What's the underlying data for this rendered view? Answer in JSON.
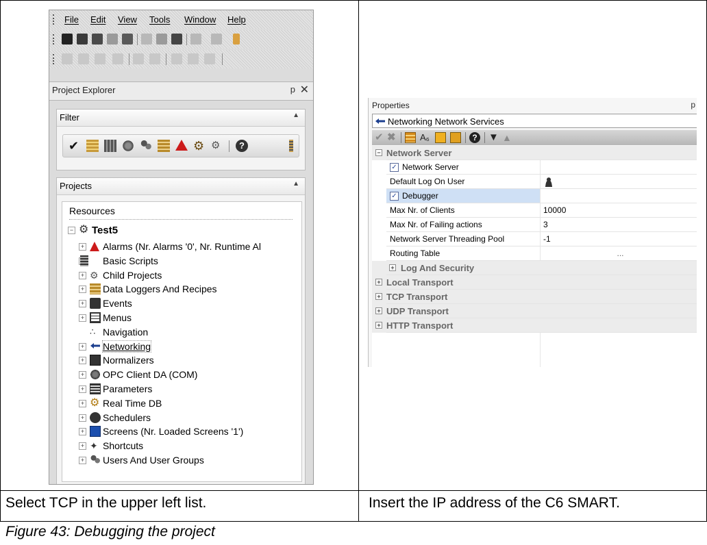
{
  "menu": {
    "items": [
      "File",
      "Edit",
      "View",
      "Tools",
      "Window",
      "Help"
    ]
  },
  "project_explorer": {
    "title": "Project Explorer",
    "pin_glyph": "p",
    "close_glyph": "✕",
    "filter": {
      "title": "Filter",
      "icons": [
        "check-icon",
        "alarm-list-icon",
        "network-icon",
        "opc-icon",
        "users-icon",
        "datalogger-icon",
        "alarm-bell-icon",
        "gear-icon",
        "child-gear-icon",
        "help-icon"
      ]
    },
    "projects": {
      "title": "Projects",
      "resources_label": "Resources",
      "root": {
        "label": "Test5",
        "icon": "project-gear-icon"
      },
      "items": [
        {
          "label": "Alarms (Nr. Alarms '0', Nr. Runtime Al",
          "icon": "alarm-bell-icon",
          "expandable": true
        },
        {
          "label": "Basic Scripts",
          "icon": "script-icon",
          "expandable": true
        },
        {
          "label": "Child Projects",
          "icon": "child-gear-icon",
          "expandable": true
        },
        {
          "label": "Data Loggers And Recipes",
          "icon": "datalogger-icon",
          "expandable": true
        },
        {
          "label": "Events",
          "icon": "events-icon",
          "expandable": true
        },
        {
          "label": "Menus",
          "icon": "menus-icon",
          "expandable": true
        },
        {
          "label": "Navigation",
          "icon": "navigation-icon",
          "expandable": false
        },
        {
          "label": "Networking",
          "icon": "networking-icon",
          "expandable": true,
          "selected": true
        },
        {
          "label": "Normalizers",
          "icon": "normalizers-icon",
          "expandable": true
        },
        {
          "label": "OPC Client DA (COM)",
          "icon": "opc-icon",
          "expandable": true
        },
        {
          "label": "Parameters",
          "icon": "parameters-icon",
          "expandable": true
        },
        {
          "label": "Real Time DB",
          "icon": "realtime-db-icon",
          "expandable": true
        },
        {
          "label": "Schedulers",
          "icon": "scheduler-icon",
          "expandable": true
        },
        {
          "label": "Screens (Nr. Loaded Screens '1')",
          "icon": "screen-icon",
          "expandable": true
        },
        {
          "label": "Shortcuts",
          "icon": "shortcut-icon",
          "expandable": true
        },
        {
          "label": "Users And User Groups",
          "icon": "users-icon",
          "expandable": true
        }
      ]
    }
  },
  "properties": {
    "title": "Properties",
    "pin_glyph": "p",
    "object_label": "Networking Network Services",
    "rows": [
      {
        "kind": "category",
        "label": "Network Server",
        "expander": "⊟"
      },
      {
        "kind": "checkbox",
        "label": "Network Server",
        "checked": true,
        "value": ""
      },
      {
        "kind": "prop",
        "label": "Default Log On User",
        "value": "",
        "value_icon": "user-icon"
      },
      {
        "kind": "checkbox",
        "label": "Debugger",
        "checked": true,
        "value": "",
        "selected": true
      },
      {
        "kind": "prop",
        "label": "Max Nr. of Clients",
        "value": "10000"
      },
      {
        "kind": "prop",
        "label": "Max Nr. of Failing actions",
        "value": "3"
      },
      {
        "kind": "prop",
        "label": "Network Server Threading Pool",
        "value": "-1"
      },
      {
        "kind": "prop",
        "label": "Routing Table",
        "value": "..."
      },
      {
        "kind": "subcategory",
        "label": "Log And Security",
        "expander": "⊞"
      },
      {
        "kind": "category",
        "label": "Local Transport",
        "expander": "⊞"
      },
      {
        "kind": "category",
        "label": "TCP Transport",
        "expander": "⊞"
      },
      {
        "kind": "category",
        "label": "UDP Transport",
        "expander": "⊞"
      },
      {
        "kind": "category",
        "label": "HTTP Transport",
        "expander": "⊞"
      }
    ]
  },
  "table": {
    "left_caption": "Select TCP in the upper left list.",
    "right_caption": "Insert the IP address of the C6 SMART."
  },
  "figure_caption": "Figure 43:    Debugging the project",
  "colors": {
    "alarm_red": "#cc1b1b",
    "selection_blue": "#cfe0f5",
    "networking_blue": "#1c3f8f"
  }
}
